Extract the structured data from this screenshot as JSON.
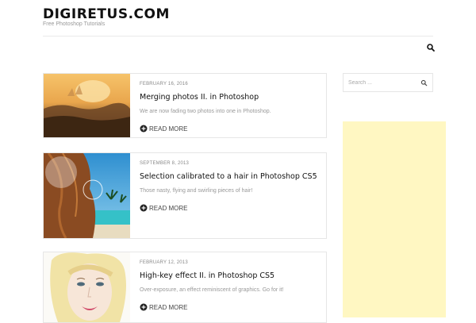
{
  "site": {
    "title": "DIGIRETUS.COM",
    "tagline": "Free Photoshop Tutorials"
  },
  "nav": {
    "search_icon": "search-icon"
  },
  "posts": [
    {
      "date": "FEBRUARY 16, 2016",
      "title": "Merging photos II. in Photoshop",
      "excerpt": "We are now fading two photos into one in Photoshop.",
      "read_more": "READ MORE",
      "image": "misty-sunrise-landscape-photo"
    },
    {
      "date": "SEPTEMBER 8, 2013",
      "title": "Selection calibrated to a hair in Photoshop CS5",
      "excerpt": "Those nasty, flying and swirling pieces of hair!",
      "read_more": "READ MORE",
      "image": "woman-hair-beach-photo"
    },
    {
      "date": "FEBRUARY 12, 2013",
      "title": "High-key effect II. in Photoshop CS5",
      "excerpt": "Over-exposure, an effect reminiscent of graphics. Go for it!",
      "read_more": "READ MORE",
      "image": "high-key-portrait-photo"
    }
  ],
  "sidebar": {
    "search_placeholder": "Search ...",
    "search_icon": "search-icon",
    "ad_color": "#fff7c2"
  },
  "colors": {
    "text": "#111111",
    "muted": "#999999",
    "border": "#e6e6e6",
    "ad_background": "#fff7c2"
  }
}
